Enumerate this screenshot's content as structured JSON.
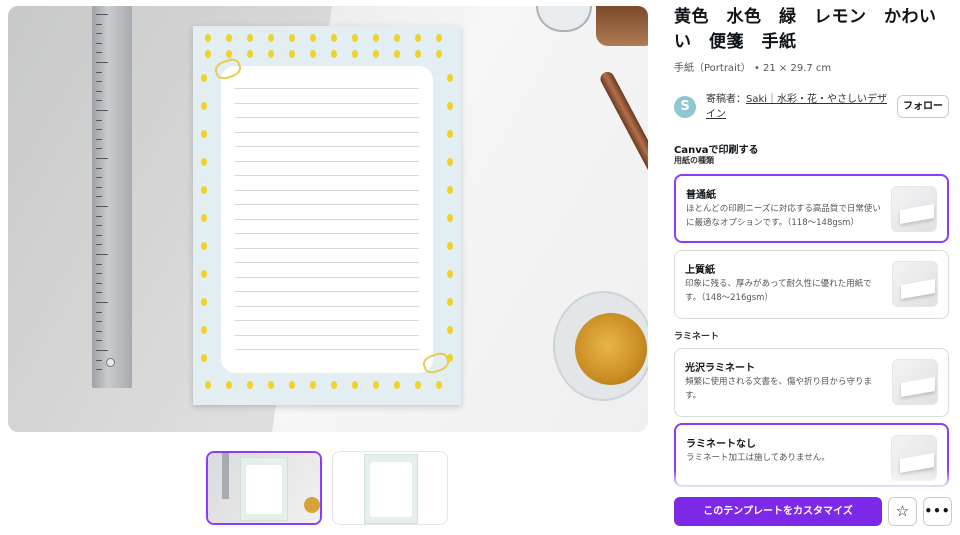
{
  "product": {
    "title": "黄色　水色　緑　レモン　かわいい　便箋　手紙",
    "subtitle": "手紙（Portrait） • 21 × 29.7 cm"
  },
  "author": {
    "avatar_letter": "S",
    "prefix": "寄稿者：",
    "name": "Saki｜水彩・花・やさしいデザイン",
    "follow_label": "フォロー"
  },
  "print": {
    "heading": "Canvaで印刷する",
    "paper_heading": "用紙の種類",
    "paper_options": [
      {
        "title": "普通紙",
        "desc": "ほとんどの印刷ニーズに対応する高品質で日常使いに最適なオプションです。（118〜148gsm）",
        "selected": true
      },
      {
        "title": "上質紙",
        "desc": "印象に残る、厚みがあって耐久性に優れた用紙です。（148〜216gsm）",
        "selected": false
      }
    ],
    "laminate_heading": "ラミネート",
    "laminate_options": [
      {
        "title": "光沢ラミネート",
        "desc": "頻繁に使用される文書を、傷や折り目から守ります。",
        "selected": false
      },
      {
        "title": "ラミネートなし",
        "desc": "ラミネート加工は施してありません。",
        "selected": true
      }
    ]
  },
  "actions": {
    "customize_label": "このテンプレートをカスタマイズ",
    "star_icon": "star-icon",
    "more_icon": "more-icon"
  },
  "colors": {
    "accent": "#7d2ae8",
    "selected_border": "#8b3dff"
  },
  "thumbnails": {
    "count": 2,
    "selected_index": 0
  }
}
